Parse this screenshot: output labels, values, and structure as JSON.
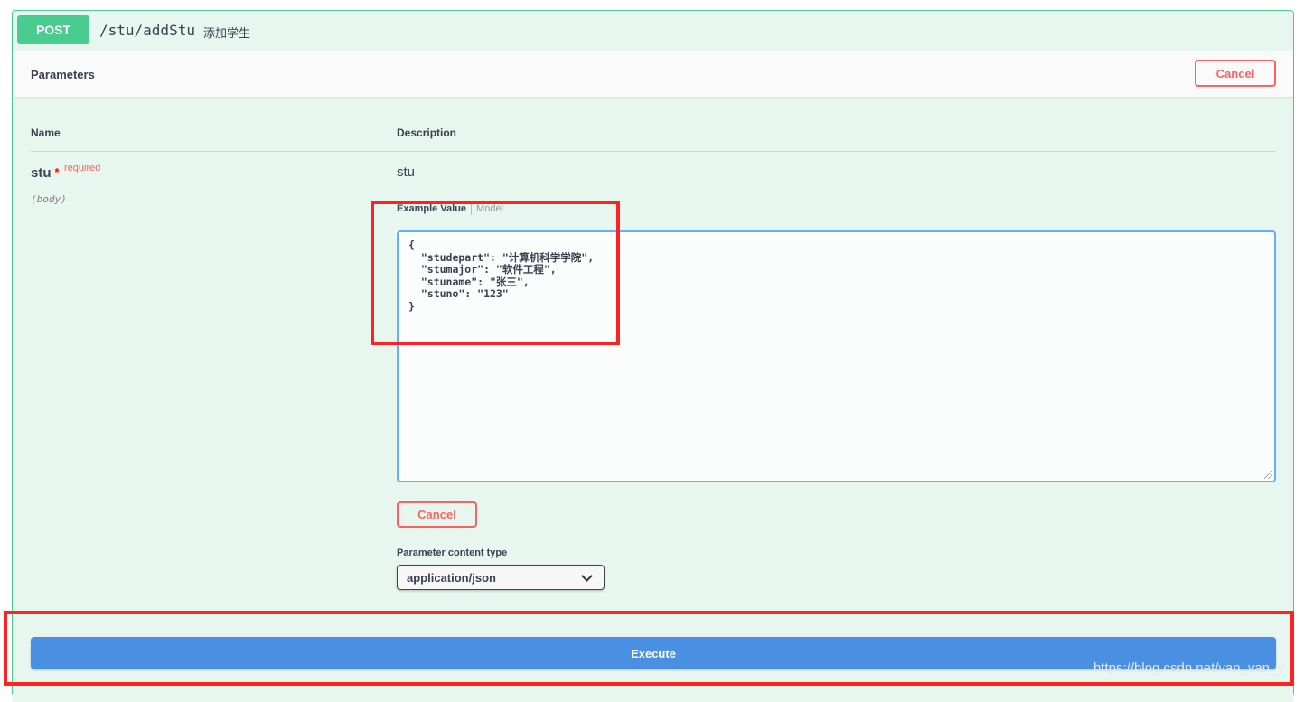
{
  "operation": {
    "method": "POST",
    "path": "/stu/addStu",
    "summary": "添加学生"
  },
  "parameters_section": {
    "title": "Parameters",
    "cancel_label": "Cancel"
  },
  "table": {
    "col_name": "Name",
    "col_description": "Description"
  },
  "param": {
    "name": "stu",
    "required_star": "*",
    "required_label": "required",
    "location": "(body)",
    "description": "stu"
  },
  "example_tabs": {
    "example_value": "Example Value",
    "model": "Model"
  },
  "request_body": "{\n  \"studepart\": \"计算机科学学院\",\n  \"stumajor\": \"软件工程\",\n  \"stuname\": \"张三\",\n  \"stuno\": \"123\"\n}",
  "body_cancel_label": "Cancel",
  "content_type": {
    "label": "Parameter content type",
    "selected": "application/json"
  },
  "execute_label": "Execute",
  "watermark": "https://blog.csdn.net/van_van_v",
  "colors": {
    "post_green": "#49cc90",
    "block_bg": "#e8f6f0",
    "cancel_red": "#ff6060",
    "execute_blue": "#4990e2",
    "highlight_red": "#ff2222"
  }
}
